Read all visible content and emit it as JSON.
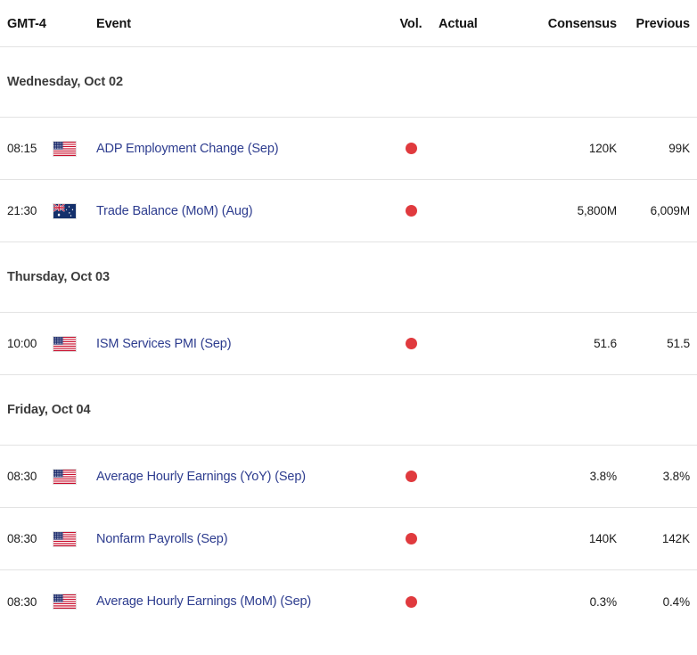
{
  "columns": {
    "timezone": "GMT-4",
    "event": "Event",
    "volatility": "Vol.",
    "actual": "Actual",
    "consensus": "Consensus",
    "previous": "Previous"
  },
  "colors": {
    "event_link": "#2e3d8f",
    "volatility_high": "#e03a3e",
    "date_header": "#3c3c3c",
    "row_border": "#e3e3e3",
    "background": "#ffffff"
  },
  "icons": {
    "volatility_dot": "red-circle-icon",
    "flag_us": "us-flag-icon",
    "flag_au": "au-flag-icon"
  },
  "sections": [
    {
      "date": "Wednesday, Oct 02",
      "events": [
        {
          "time": "08:15",
          "country": "us",
          "flag_name": "us-flag-icon",
          "event": "ADP Employment Change (Sep)",
          "volatility": "high",
          "actual": "",
          "consensus": "120K",
          "previous": "99K"
        },
        {
          "time": "21:30",
          "country": "au",
          "flag_name": "au-flag-icon",
          "event": "Trade Balance (MoM) (Aug)",
          "volatility": "high",
          "actual": "",
          "consensus": "5,800M",
          "previous": "6,009M"
        }
      ]
    },
    {
      "date": "Thursday, Oct 03",
      "events": [
        {
          "time": "10:00",
          "country": "us",
          "flag_name": "us-flag-icon",
          "event": "ISM Services PMI (Sep)",
          "volatility": "high",
          "actual": "",
          "consensus": "51.6",
          "previous": "51.5"
        }
      ]
    },
    {
      "date": "Friday, Oct 04",
      "events": [
        {
          "time": "08:30",
          "country": "us",
          "flag_name": "us-flag-icon",
          "event": "Average Hourly Earnings (YoY) (Sep)",
          "volatility": "high",
          "actual": "",
          "consensus": "3.8%",
          "previous": "3.8%"
        },
        {
          "time": "08:30",
          "country": "us",
          "flag_name": "us-flag-icon",
          "event": "Nonfarm Payrolls (Sep)",
          "volatility": "high",
          "actual": "",
          "consensus": "140K",
          "previous": "142K"
        },
        {
          "time": "08:30",
          "country": "us",
          "flag_name": "us-flag-icon",
          "event": "Average Hourly Earnings (MoM) (Sep)",
          "volatility": "high",
          "actual": "",
          "consensus": "0.3%",
          "previous": "0.4%"
        }
      ]
    }
  ]
}
